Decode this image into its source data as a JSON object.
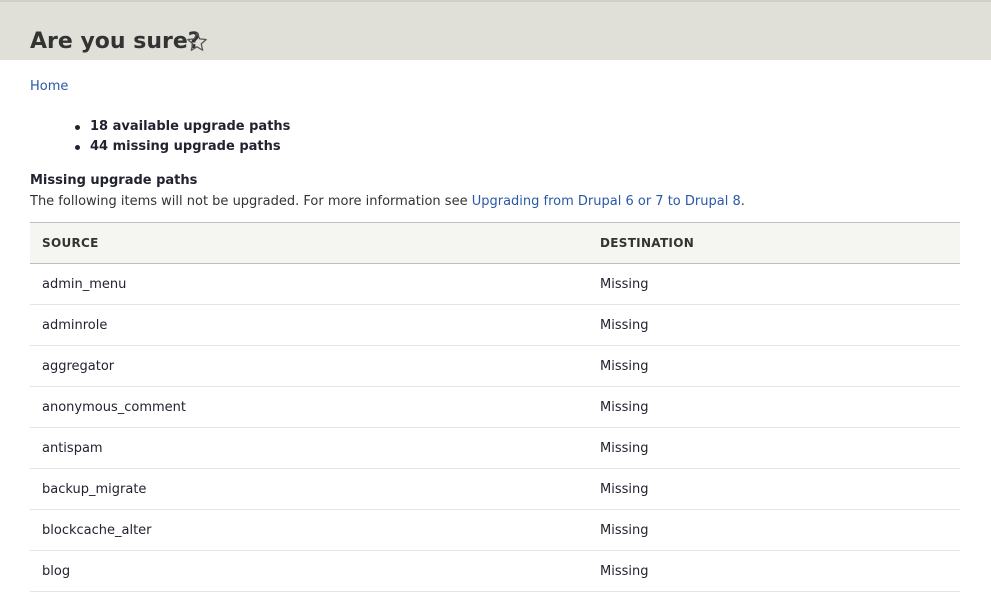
{
  "page": {
    "title": "Are you sure?"
  },
  "breadcrumb": {
    "home": "Home"
  },
  "summary": [
    "18 available upgrade paths",
    "44 missing upgrade paths"
  ],
  "missing": {
    "title": "Missing upgrade paths",
    "description_text": "The following items will not be upgraded. For more information see ",
    "description_link": "Upgrading from Drupal 6 or 7 to Drupal 8",
    "description_end": "."
  },
  "table": {
    "headers": {
      "source": "SOURCE",
      "destination": "DESTINATION"
    },
    "rows": [
      {
        "source": "admin_menu",
        "destination": "Missing"
      },
      {
        "source": "adminrole",
        "destination": "Missing"
      },
      {
        "source": "aggregator",
        "destination": "Missing"
      },
      {
        "source": "anonymous_comment",
        "destination": "Missing"
      },
      {
        "source": "antispam",
        "destination": "Missing"
      },
      {
        "source": "backup_migrate",
        "destination": "Missing"
      },
      {
        "source": "blockcache_alter",
        "destination": "Missing"
      },
      {
        "source": "blog",
        "destination": "Missing"
      }
    ]
  },
  "icons": {
    "favorite": "star-outline-icon"
  },
  "colors": {
    "header_bg": "#e0e0d8",
    "link": "#2a58a8",
    "table_header_bg": "#f5f5f2"
  }
}
